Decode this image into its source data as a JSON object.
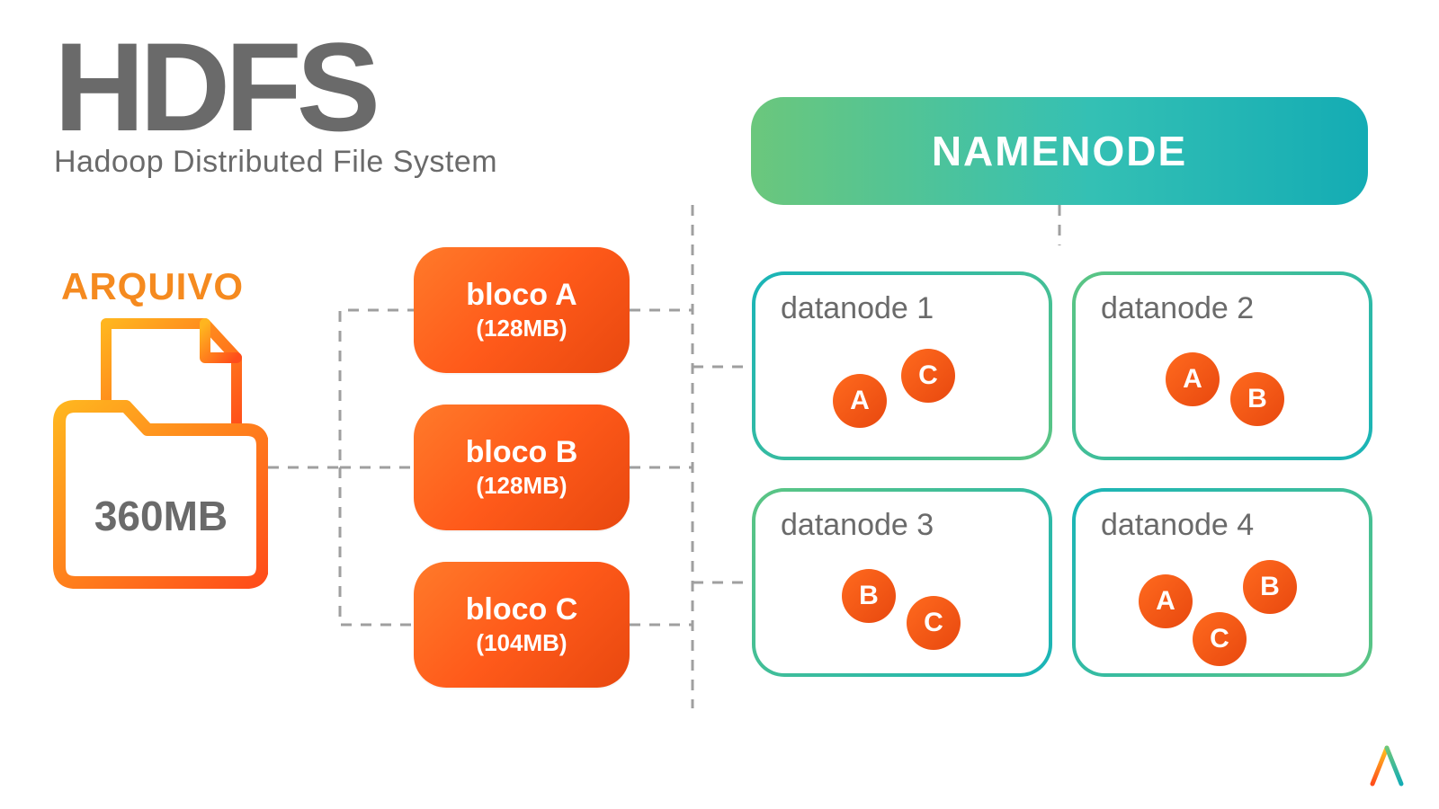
{
  "title": {
    "main": "HDFS",
    "sub": "Hadoop Distributed File System"
  },
  "arquivo": {
    "label": "ARQUIVO",
    "size": "360MB"
  },
  "blocks": [
    {
      "name": "bloco A",
      "size": "(128MB)"
    },
    {
      "name": "bloco B",
      "size": "(128MB)"
    },
    {
      "name": "bloco C",
      "size": "(104MB)"
    }
  ],
  "namenode": {
    "label": "NAMENODE"
  },
  "datanodes": [
    {
      "label": "datanode 1",
      "chips": [
        "A",
        "C"
      ]
    },
    {
      "label": "datanode 2",
      "chips": [
        "A",
        "B"
      ]
    },
    {
      "label": "datanode 3",
      "chips": [
        "B",
        "C"
      ]
    },
    {
      "label": "datanode 4",
      "chips": [
        "A",
        "B",
        "C"
      ]
    }
  ],
  "colors": {
    "orange_start": "#ff7a2a",
    "orange_end": "#e8480f",
    "teal_start": "#6bc77c",
    "teal_end": "#14acb4",
    "grey": "#6a6a6a",
    "dash": "#9f9f9f"
  }
}
